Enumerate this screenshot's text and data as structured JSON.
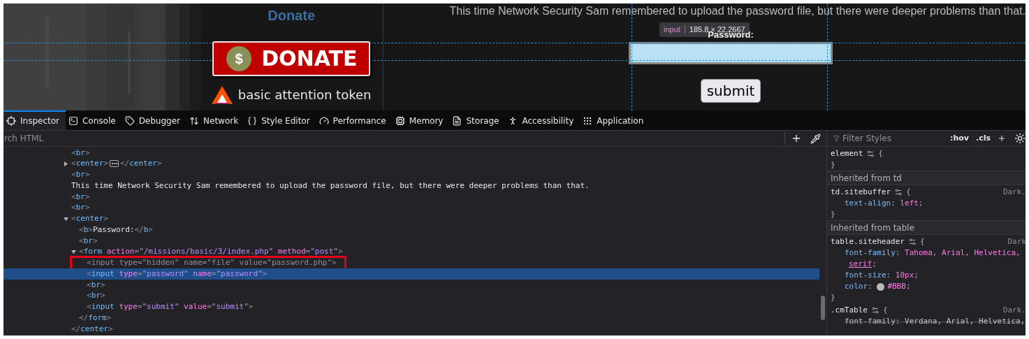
{
  "page": {
    "donate_heading": "Donate",
    "donate_button": {
      "symbol": "$",
      "label": "DONATE"
    },
    "sponsor": {
      "label": "basic attention token"
    },
    "intro_text": "This time Network Security Sam remembered to upload the password file, but there were deeper problems than that.",
    "password_label": "Password:",
    "password_field": {
      "highlighted": true
    },
    "submit_button": "submit",
    "tooltip": {
      "tag": "input",
      "size": "185.8 × 22.2667"
    }
  },
  "devtools": {
    "tabs": [
      {
        "label": "Inspector",
        "selected": true
      },
      {
        "label": "Console",
        "selected": false
      },
      {
        "label": "Debugger",
        "selected": false
      },
      {
        "label": "Network",
        "selected": false
      },
      {
        "label": "Style Editor",
        "selected": false
      },
      {
        "label": "Performance",
        "selected": false
      },
      {
        "label": "Memory",
        "selected": false
      },
      {
        "label": "Storage",
        "selected": false
      },
      {
        "label": "Accessibility",
        "selected": false
      },
      {
        "label": "Application",
        "selected": false
      }
    ],
    "search": {
      "placeholder": "rch HTML"
    },
    "markup": [
      {
        "kind": "tag",
        "markup": "<br>",
        "selected": false,
        "dimmed": false,
        "flagged": false
      },
      {
        "kind": "tag",
        "markup": "<center>",
        "close": "</center>",
        "expanded": false,
        "selected": false,
        "dimmed": false,
        "flagged": false
      },
      {
        "kind": "tag",
        "markup": "<br>",
        "selected": false,
        "dimmed": false,
        "flagged": false
      },
      {
        "kind": "text",
        "text": "This time Network Security Sam remembered to upload the password file, but there were deeper problems than that."
      },
      {
        "kind": "tag",
        "markup": "<br>",
        "selected": false,
        "dimmed": false,
        "flagged": false
      },
      {
        "kind": "tag",
        "markup": "<br>",
        "selected": false,
        "dimmed": false,
        "flagged": false
      },
      {
        "kind": "tag",
        "markup": "<center>",
        "close": "</center>",
        "expanded": true,
        "selected": false,
        "dimmed": false,
        "flagged": false,
        "children": [
          {
            "kind": "tag",
            "markup": "<b>Password:</b>",
            "selected": false,
            "dimmed": false,
            "flagged": false
          },
          {
            "kind": "tag",
            "markup": "<br>",
            "selected": false,
            "dimmed": false,
            "flagged": false
          },
          {
            "kind": "tag",
            "markup": "<form action=\"/missions/basic/3/index.php\" method=\"post\">",
            "close": "</form>",
            "expanded": true,
            "selected": false,
            "dimmed": false,
            "flagged": false,
            "children": [
              {
                "kind": "tag",
                "markup": "<input type=\"hidden\" name=\"file\" value=\"password.php\">",
                "selected": false,
                "dimmed": true,
                "flagged": true
              },
              {
                "kind": "tag",
                "markup": "<input type=\"password\" name=\"password\">",
                "selected": true,
                "dimmed": false,
                "flagged": false
              },
              {
                "kind": "tag",
                "markup": "<br>",
                "selected": false,
                "dimmed": false,
                "flagged": false
              },
              {
                "kind": "tag",
                "markup": "<br>",
                "selected": false,
                "dimmed": false,
                "flagged": false
              },
              {
                "kind": "tag",
                "markup": "<input type=\"submit\" value=\"submit\">",
                "selected": false,
                "dimmed": false,
                "flagged": false
              }
            ]
          }
        ]
      }
    ],
    "styles": {
      "filter_placeholder": "Filter Styles",
      "hov": ":hov",
      "cls": ".cls",
      "sections": [
        {
          "kind": "rule",
          "selector": "element",
          "open": "{",
          "close": "}"
        },
        {
          "kind": "header",
          "text": "Inherited from td"
        },
        {
          "kind": "rule",
          "selector": "td.sitebuffer",
          "source": "Dark.",
          "open": "{",
          "close": "}",
          "declarations": [
            {
              "text": "text-align: left;",
              "struck": false
            }
          ]
        },
        {
          "kind": "header",
          "text": "Inherited from table"
        },
        {
          "kind": "rule",
          "selector": "table.siteheader",
          "source": "Dark",
          "open": "{",
          "close": "}",
          "declarations": [
            {
              "text": "font-family: Tahoma, Arial, Helvetica,",
              "continuation": "serif;",
              "struck": false
            },
            {
              "text": "font-size: 10px;",
              "struck": false
            },
            {
              "text": "color: #BBB;",
              "color": "#bbbbbb",
              "struck": false
            }
          ]
        },
        {
          "kind": "rule",
          "selector": ".cmTable",
          "source": "Dark.",
          "open": "{",
          "declarations": [
            {
              "text": "font-family: Verdana, Arial, Helvetica,",
              "struck": true
            }
          ]
        }
      ]
    }
  }
}
